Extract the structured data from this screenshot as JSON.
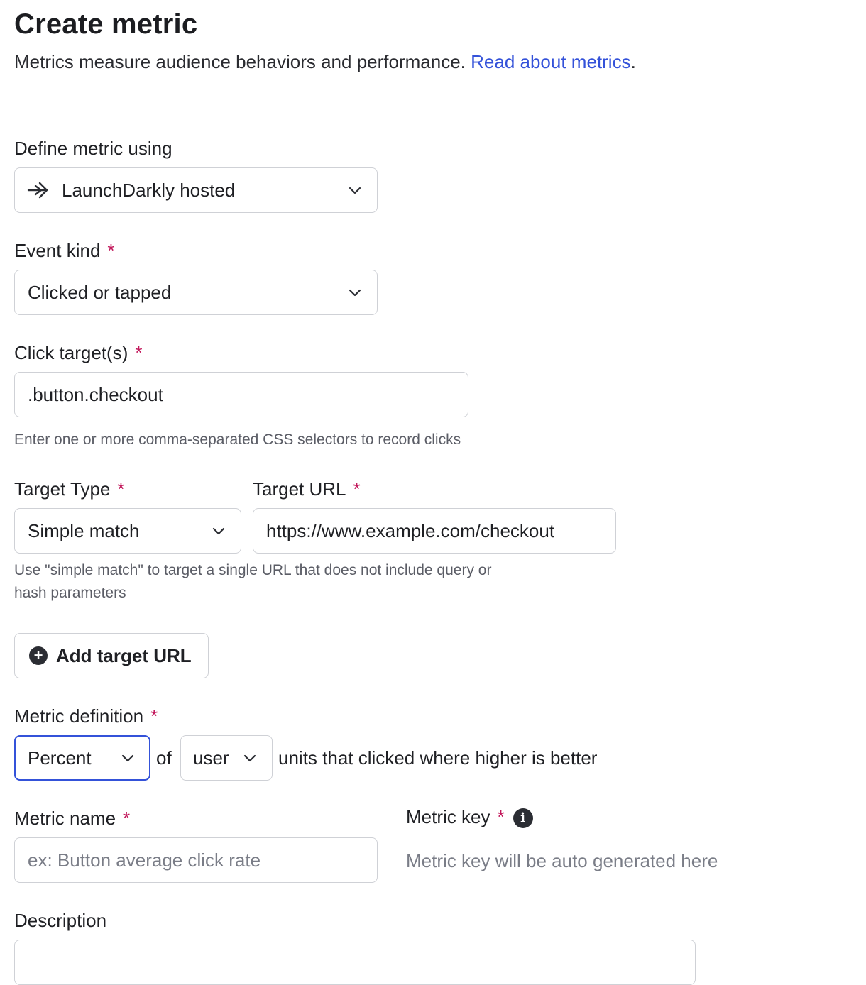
{
  "header": {
    "title": "Create metric",
    "subtitle": "Metrics measure audience behaviors and performance.",
    "link": "Read about metrics",
    "link_suffix": "."
  },
  "define_metric": {
    "label": "Define metric using",
    "value": "LaunchDarkly hosted",
    "icon": "arrow-right-icon"
  },
  "event_kind": {
    "label": "Event kind",
    "required": "*",
    "value": "Clicked or tapped"
  },
  "click_targets": {
    "label": "Click target(s)",
    "required": "*",
    "value": ".button.checkout",
    "hint": "Enter one or more comma-separated CSS selectors to record clicks"
  },
  "target_type": {
    "label": "Target Type",
    "required": "*",
    "value": "Simple match"
  },
  "target_url": {
    "label": "Target URL",
    "required": "*",
    "value": "https://www.example.com/checkout",
    "hint_line1": "Use \"simple match\" to target a single URL that does not include query or",
    "hint_line2": "hash parameters"
  },
  "add_target_url": {
    "label": "Add target URL",
    "icon": "plus-circle-icon"
  },
  "metric_definition": {
    "label": "Metric definition",
    "required": "*",
    "aggregation": "Percent",
    "of_text": "of",
    "unit": "user",
    "suffix": "units that clicked where higher is better"
  },
  "metric_name": {
    "label": "Metric name",
    "required": "*",
    "placeholder": "ex: Button average click rate"
  },
  "metric_key": {
    "label": "Metric key",
    "required": "*",
    "placeholder": "Metric key will be auto generated here",
    "icon": "info-icon"
  },
  "description": {
    "label": "Description"
  }
}
